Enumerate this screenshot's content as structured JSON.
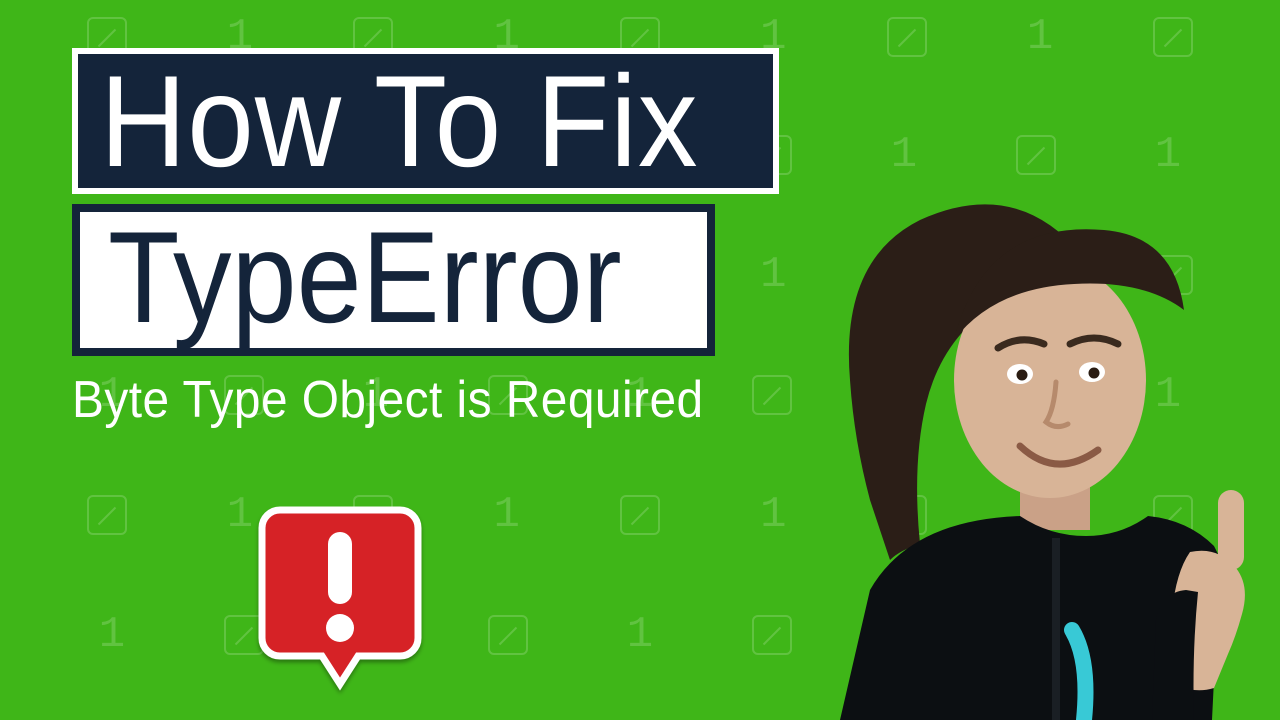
{
  "thumbnail": {
    "line1": "How To Fix",
    "line2": "TypeError",
    "subtitle": "Byte Type Object is Required"
  },
  "badge": {
    "name": "alert-exclamation-icon",
    "color": "#d62027",
    "glyph_color": "#ffffff"
  },
  "palette": {
    "bg": "#3fb618",
    "navy": "#14243a",
    "white": "#ffffff"
  },
  "pattern": {
    "glyphs": [
      "1",
      "0"
    ]
  }
}
